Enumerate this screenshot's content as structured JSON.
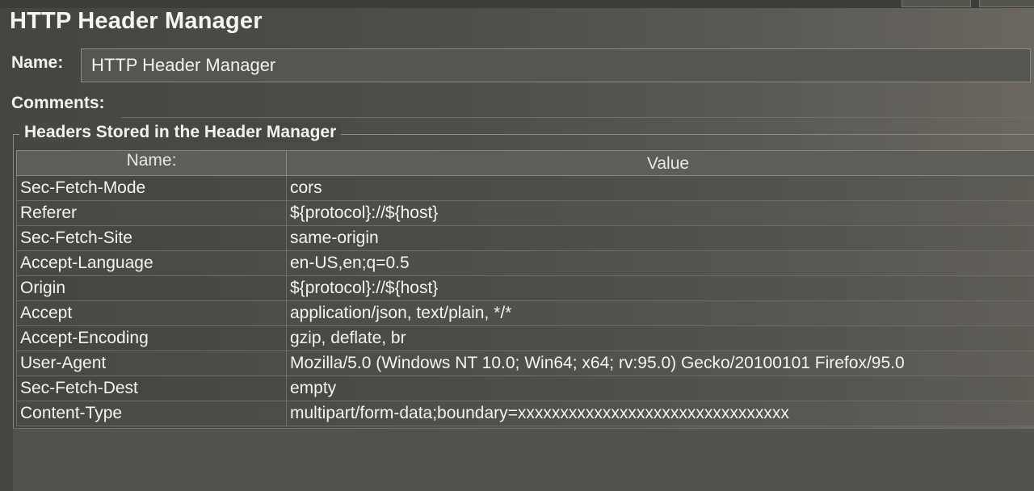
{
  "panel": {
    "title": "HTTP Header Manager"
  },
  "name_field": {
    "label": "Name:",
    "value": "HTTP Header Manager"
  },
  "comments_field": {
    "label": "Comments:",
    "value": ""
  },
  "headers_section": {
    "legend": "Headers Stored in the Header Manager",
    "columns": {
      "name": "Name:",
      "value": "Value"
    },
    "rows": [
      {
        "name": "Sec-Fetch-Mode",
        "value": "cors"
      },
      {
        "name": "Referer",
        "value": "${protocol}://${host}"
      },
      {
        "name": "Sec-Fetch-Site",
        "value": "same-origin"
      },
      {
        "name": "Accept-Language",
        "value": "en-US,en;q=0.5"
      },
      {
        "name": "Origin",
        "value": "${protocol}://${host}"
      },
      {
        "name": "Accept",
        "value": "application/json, text/plain, */*"
      },
      {
        "name": "Accept-Encoding",
        "value": "gzip, deflate, br"
      },
      {
        "name": "User-Agent",
        "value": "Mozilla/5.0 (Windows NT 10.0; Win64; x64; rv:95.0) Gecko/20100101 Firefox/95.0"
      },
      {
        "name": "Sec-Fetch-Dest",
        "value": "empty"
      },
      {
        "name": "Content-Type",
        "value": "multipart/form-data;boundary=xxxxxxxxxxxxxxxxxxxxxxxxxxxxxxxx"
      }
    ]
  }
}
